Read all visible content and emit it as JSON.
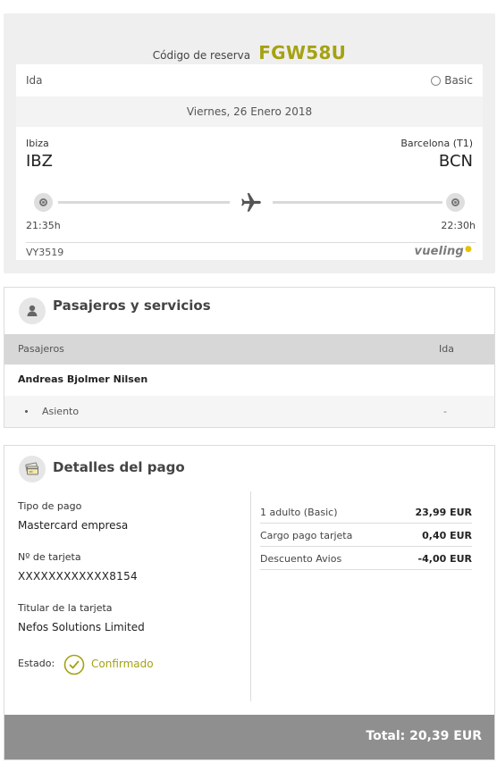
{
  "reservation": {
    "label": "Código de reserva",
    "code": "FGW58U"
  },
  "flight": {
    "direction": "Ida",
    "fare": "Basic",
    "date": "Viernes, 26 Enero 2018",
    "origin": {
      "city": "Ibiza",
      "code": "IBZ",
      "time": "21:35h"
    },
    "destination": {
      "city": "Barcelona (T1)",
      "code": "BCN",
      "time": "22:30h"
    },
    "flight_number": "VY3519",
    "airline": "vueling"
  },
  "passengers": {
    "title": "Pasajeros y servicios",
    "columns": [
      "Pasajeros",
      "Ida"
    ],
    "name": "Andreas Bjolmer Nilsen",
    "services": [
      {
        "name": "Asiento",
        "value": "-"
      }
    ]
  },
  "payment": {
    "title": "Detalles del pago",
    "type_label": "Tipo de pago",
    "type_value": "Mastercard empresa",
    "card_label": "Nº de tarjeta",
    "card_value": "XXXXXXXXXXXX8154",
    "holder_label": "Titular de la tarjeta",
    "holder_value": "Nefos Solutions Limited",
    "status_label": "Estado:",
    "status_value": "Confirmado",
    "items": [
      {
        "label": "1 adulto (Basic)",
        "value": "23,99 EUR"
      },
      {
        "label": "Cargo pago tarjeta",
        "value": "0,40 EUR"
      },
      {
        "label": "Descuento Avios",
        "value": "-4,00 EUR"
      }
    ],
    "total": "Total: 20,39 EUR"
  },
  "colors": {
    "accent": "#a5a212",
    "total_bar": "#8f8f8f"
  },
  "icons": [
    "radio-icon",
    "origin-node-icon",
    "plane-icon",
    "destination-node-icon",
    "passenger-icon",
    "payment-card-icon",
    "check-circle-icon"
  ]
}
